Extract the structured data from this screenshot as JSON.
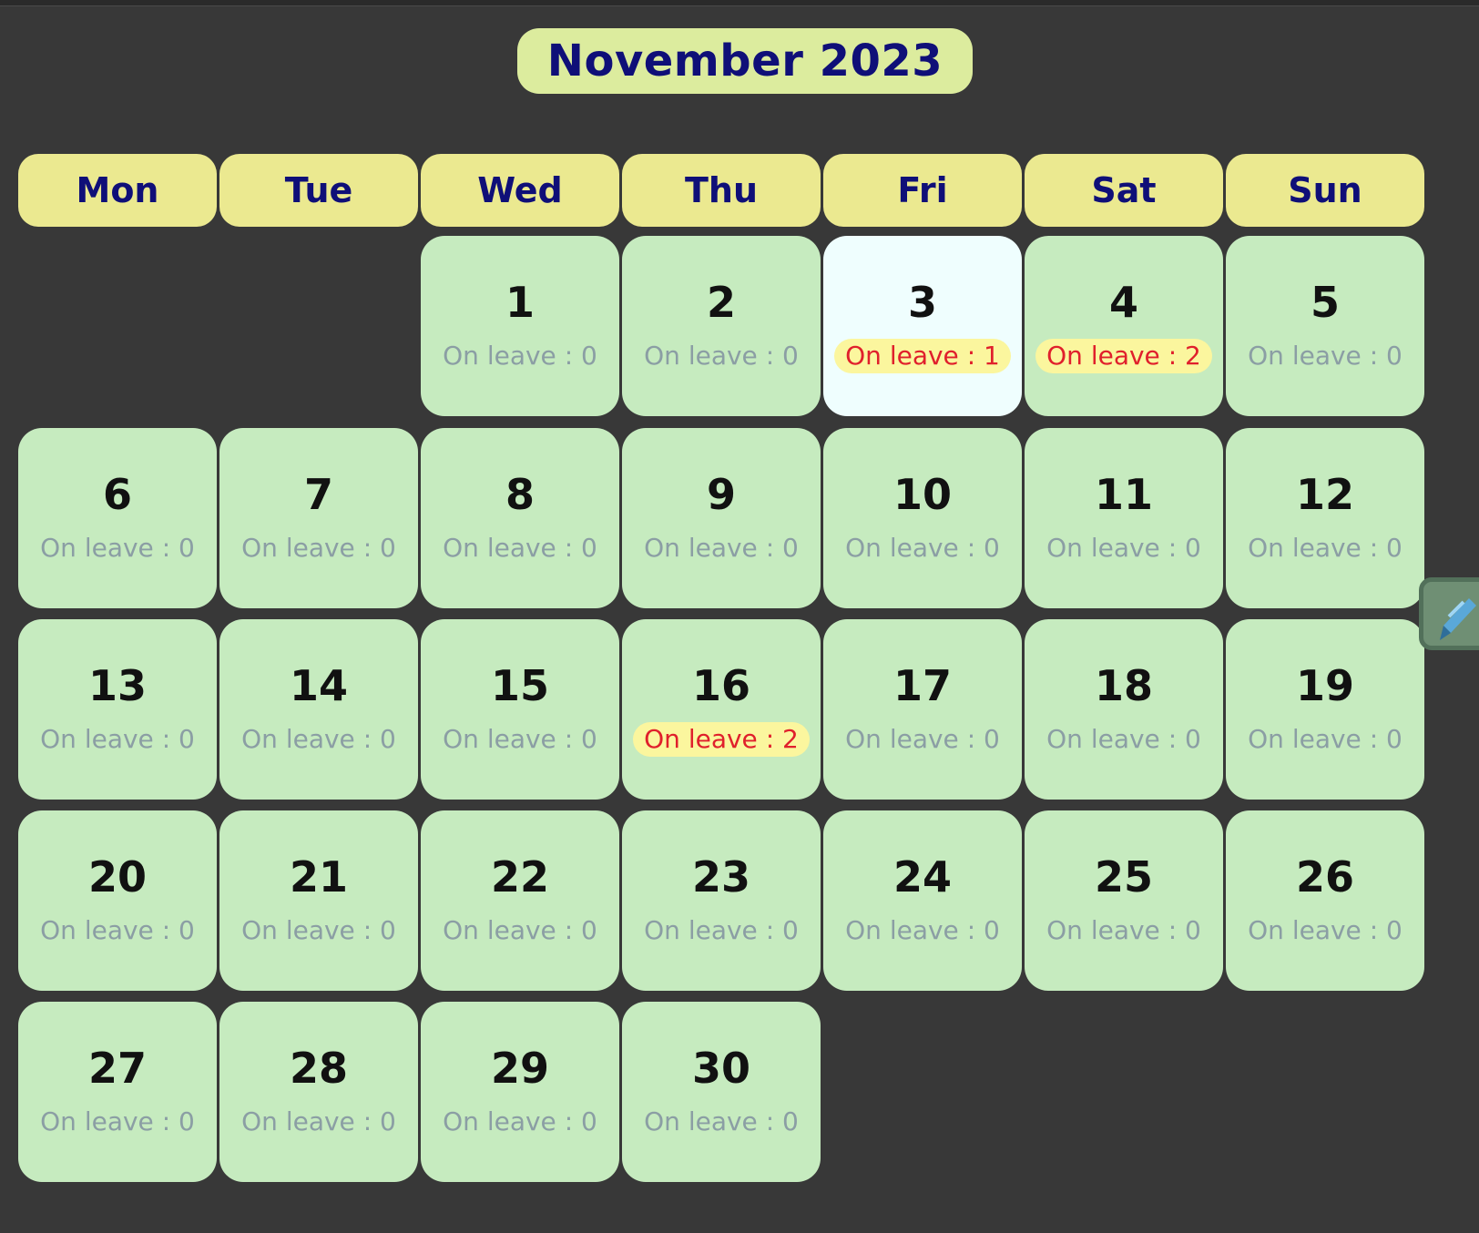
{
  "calendar": {
    "title": "November 2023",
    "weekdays": [
      "Mon",
      "Tue",
      "Wed",
      "Thu",
      "Fri",
      "Sat",
      "Sun"
    ],
    "start_weekday_index": 2,
    "today": 3,
    "leave_prefix": "On leave : ",
    "days": [
      {
        "day": "1",
        "on_leave": 0
      },
      {
        "day": "2",
        "on_leave": 0
      },
      {
        "day": "3",
        "on_leave": 1
      },
      {
        "day": "4",
        "on_leave": 2
      },
      {
        "day": "5",
        "on_leave": 0
      },
      {
        "day": "6",
        "on_leave": 0
      },
      {
        "day": "7",
        "on_leave": 0
      },
      {
        "day": "8",
        "on_leave": 0
      },
      {
        "day": "9",
        "on_leave": 0
      },
      {
        "day": "10",
        "on_leave": 0
      },
      {
        "day": "11",
        "on_leave": 0
      },
      {
        "day": "12",
        "on_leave": 0
      },
      {
        "day": "13",
        "on_leave": 0
      },
      {
        "day": "14",
        "on_leave": 0
      },
      {
        "day": "15",
        "on_leave": 0
      },
      {
        "day": "16",
        "on_leave": 2
      },
      {
        "day": "17",
        "on_leave": 0
      },
      {
        "day": "18",
        "on_leave": 0
      },
      {
        "day": "19",
        "on_leave": 0
      },
      {
        "day": "20",
        "on_leave": 0
      },
      {
        "day": "21",
        "on_leave": 0
      },
      {
        "day": "22",
        "on_leave": 0
      },
      {
        "day": "23",
        "on_leave": 0
      },
      {
        "day": "24",
        "on_leave": 0
      },
      {
        "day": "25",
        "on_leave": 0
      },
      {
        "day": "26",
        "on_leave": 0
      },
      {
        "day": "27",
        "on_leave": 0
      },
      {
        "day": "28",
        "on_leave": 0
      },
      {
        "day": "29",
        "on_leave": 0
      },
      {
        "day": "30",
        "on_leave": 0
      }
    ]
  },
  "side_handle": {
    "icon": "pencil-icon"
  },
  "colors": {
    "background": "#383838",
    "title_bg": "#dcec9e",
    "weekday_bg": "#ebe990",
    "cell_bg": "#c6ebbf",
    "today_bg": "#effefe",
    "leave_badge_bg": "#fbf69e",
    "leave_badge_text": "#e0202c",
    "leave_zero_text": "#8b9ea4",
    "header_text": "#0f0f78"
  }
}
